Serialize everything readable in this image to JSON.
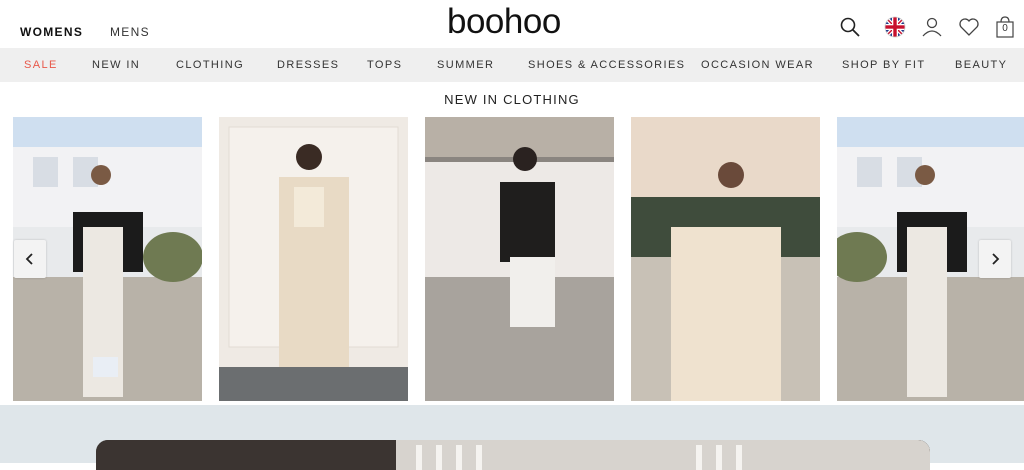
{
  "header": {
    "logo": "boohoo",
    "genders": [
      {
        "label": "WOMENS",
        "active": true
      },
      {
        "label": "MENS",
        "active": false
      }
    ],
    "bag_count": "0"
  },
  "nav": {
    "items": [
      {
        "label": "SALE"
      },
      {
        "label": "NEW IN"
      },
      {
        "label": "CLOTHING"
      },
      {
        "label": "DRESSES"
      },
      {
        "label": "TOPS"
      },
      {
        "label": "SUMMER"
      },
      {
        "label": "SHOES & ACCESSORIES"
      },
      {
        "label": "OCCASION WEAR"
      },
      {
        "label": "SHOP BY FIT"
      },
      {
        "label": "BEAUTY"
      }
    ]
  },
  "section": {
    "title": "NEW IN CLOTHING"
  },
  "colors": {
    "sale": "#e8584a",
    "nav_bg": "#efefef",
    "banner_bg": "#dfe6ea"
  }
}
